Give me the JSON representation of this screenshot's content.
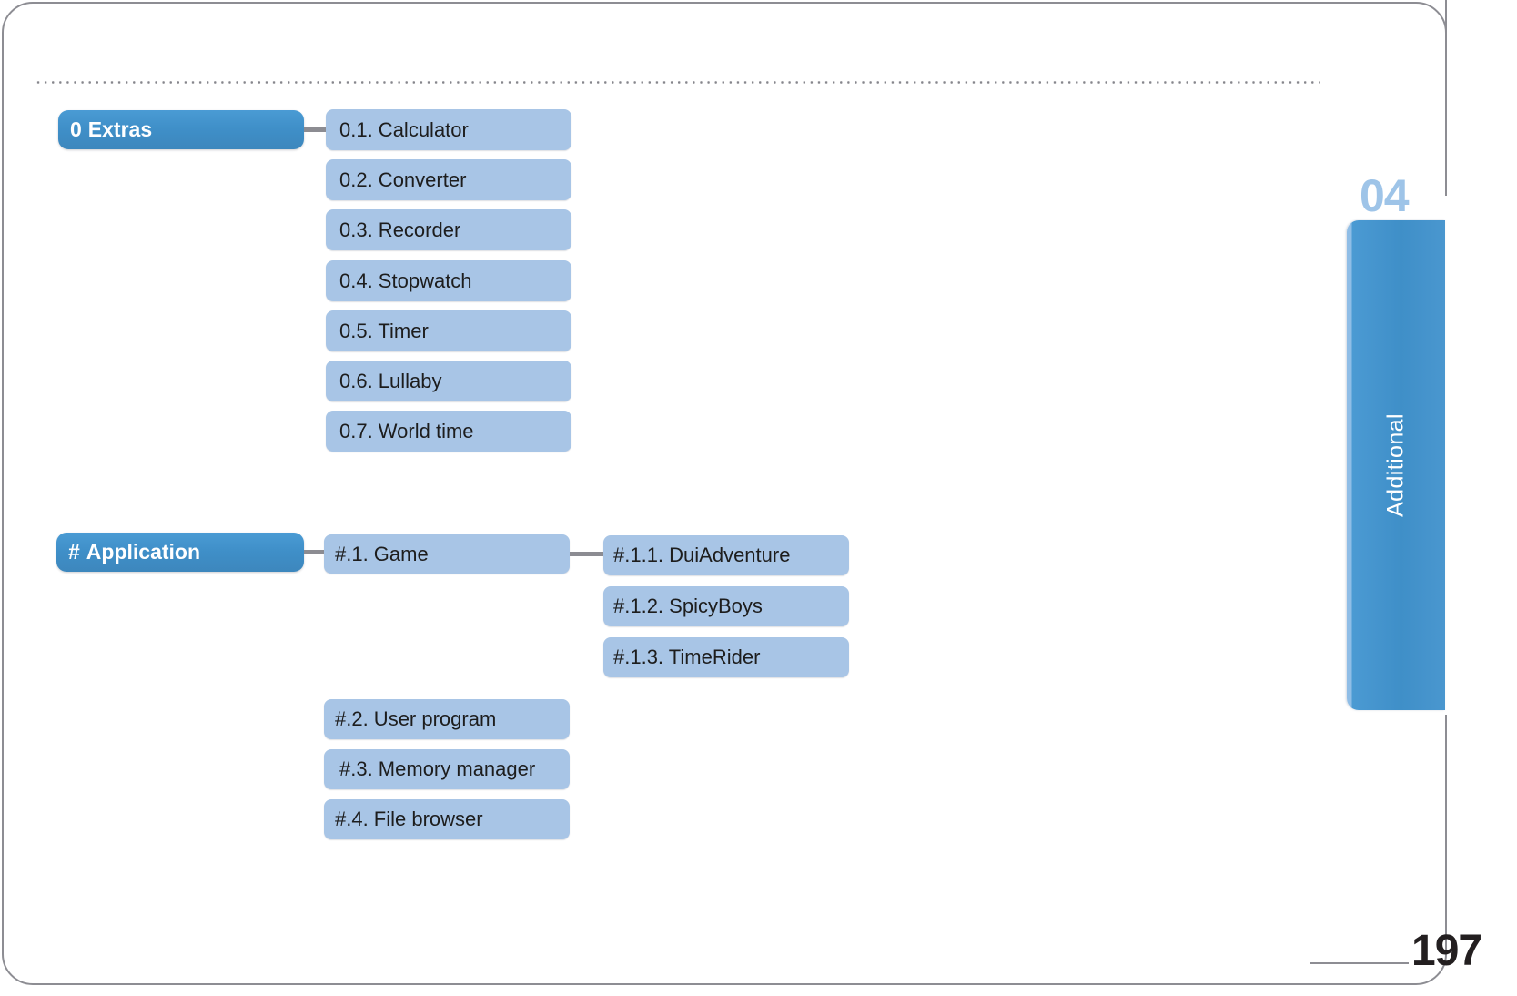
{
  "page": {
    "number": "197",
    "chapter_number": "04",
    "chapter_tab_label": "Additional"
  },
  "colors": {
    "heading_blue": "#3f8fc8",
    "node_blue": "#a8c5e6",
    "tab_blue": "#3f8fc8",
    "chapter_num_blue": "#9ec4e8",
    "frame_gray": "#8d8d93",
    "connector_gray": "#8c8c92",
    "text_dark": "#1d1d1d"
  },
  "tree": {
    "groups": [
      {
        "heading": {
          "num": "0",
          "label": "Extras"
        },
        "children": [
          {
            "label": "0.1.  Calculator"
          },
          {
            "label": "0.2.  Converter"
          },
          {
            "label": "0.3.  Recorder"
          },
          {
            "label": "0.4.  Stopwatch"
          },
          {
            "label": "0.5.  Timer"
          },
          {
            "label": "0.6.  Lullaby"
          },
          {
            "label": "0.7.  World time"
          }
        ]
      },
      {
        "heading": {
          "num": "#",
          "label": "Application"
        },
        "children": [
          {
            "label": "#.1. Game"
          },
          {
            "label": "#.2. User program"
          },
          {
            "label": "#.3. Memory manager"
          },
          {
            "label": "#.4. File browser"
          }
        ],
        "grandchildren": [
          {
            "label": "#.1.1. DuiAdventure"
          },
          {
            "label": "#.1.2. SpicyBoys"
          },
          {
            "label": "#.1.3. TimeRider"
          }
        ]
      }
    ]
  }
}
